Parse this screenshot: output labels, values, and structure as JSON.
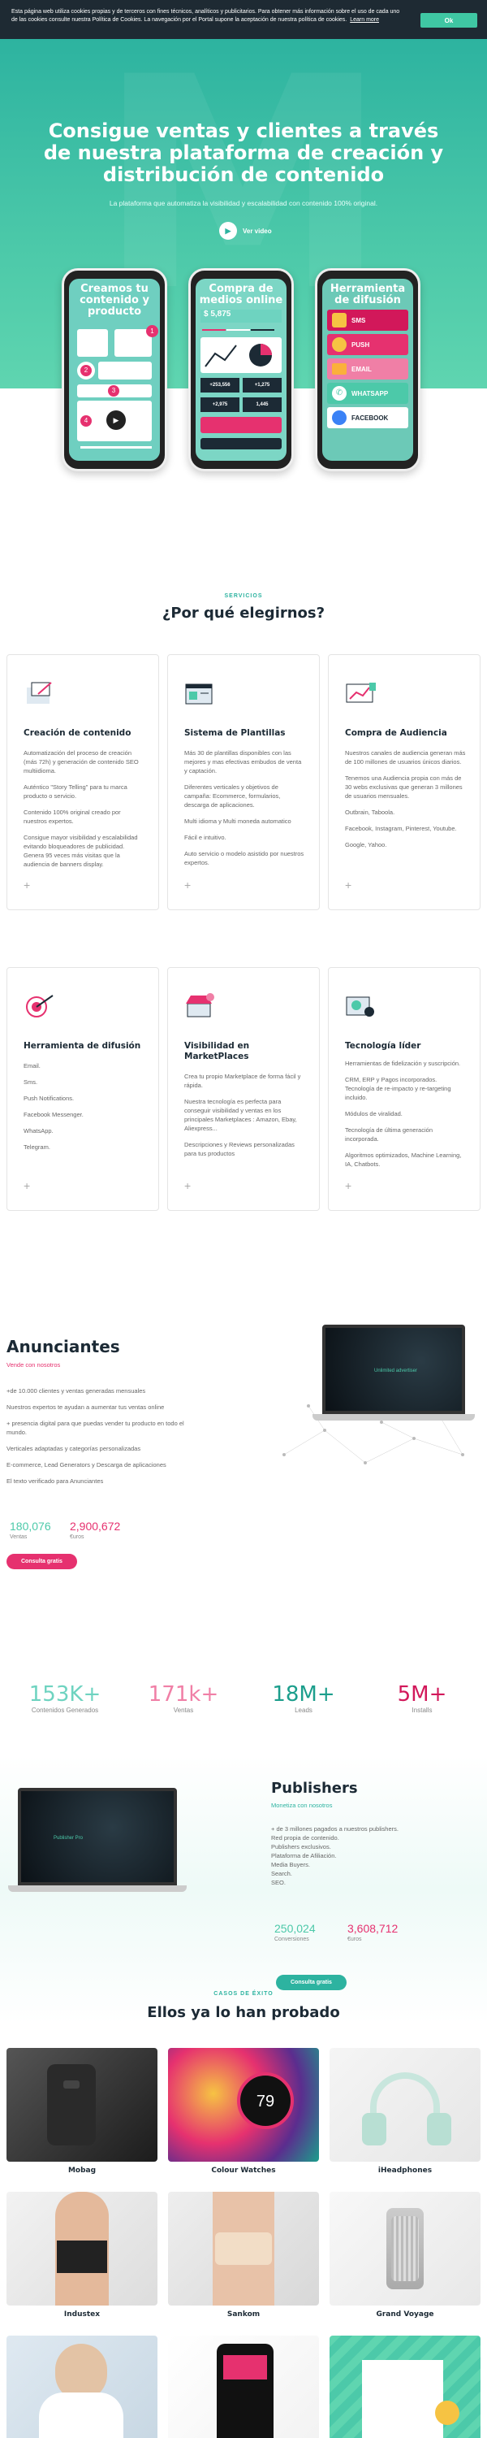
{
  "cookie": {
    "text": "Esta página web utiliza cookies propias y de terceros con fines técnicos, analíticos y publicitarios. Para obtener más información sobre el uso de cada uno de las cookies consulte nuestra Política de Cookies. La navegación por el Portal supone la aceptación de nuestra política de cookies.",
    "learn_more": "Learn more",
    "ok_label": "Ok"
  },
  "hero": {
    "title": "Consigue ventas y clientes a través de nuestra plataforma de creación y distribución de contenido",
    "subtitle": "La plataforma que automatiza la visibilidad y escalabilidad con contenido 100% original.",
    "video_label": "Ver video",
    "phone1_title": "Creamos tu contenido y producto",
    "phone2_title": "Compra de medios online",
    "phone2_value": "$ 5,875",
    "phone2_stats": [
      "+253,556",
      "+1,275",
      "+2,975",
      "1,445"
    ],
    "phone3_title": "Herramienta de difusión",
    "phone3_items": [
      "SMS",
      "PUSH",
      "EMAIL",
      "WHATSAPP",
      "FACEBOOK"
    ]
  },
  "services": {
    "eyebrow": "SERVICIOS",
    "title": "¿Por qué elegirnos?",
    "cards": [
      {
        "title": "Creación de contenido",
        "lines": [
          "Automatización del proceso de creación (más 72h) y generación de contenido SEO multiidioma.",
          "Auténtico \"Story Telling\" para tu marca producto o servicio.",
          "Contenido 100% original creado por nuestros expertos.",
          "Consigue mayor visibilidad y escalabilidad evitando bloqueadores de publicidad. Genera 95 veces más visitas que la audiencia de banners display."
        ]
      },
      {
        "title": "Sistema de Plantillas",
        "lines": [
          "Más 30 de plantillas disponibles con las mejores y mas efectivas embudos de venta y captación.",
          "Diferentes verticales y objetivos de campaña: Ecommerce, formularios, descarga de aplicaciones.",
          "Multi idioma y Multi moneda automatico",
          "Fácil e intuitivo.",
          "Auto servicio o modelo asistido por nuestros expertos."
        ]
      },
      {
        "title": "Compra de Audiencia",
        "lines": [
          "Nuestros canales de audiencia generan más de 100 millones de usuarios únicos diarios.",
          "Tenemos una Audiencia propia con más de 30 webs exclusivas que generan 3 millones de usuarios mensuales.",
          "Outbrain, Taboola.",
          "Facebook, Instagram, Pinterest, Youtube.",
          "Google, Yahoo."
        ]
      },
      {
        "title": "Herramienta de difusión",
        "lines": [
          "Email.",
          "Sms.",
          "Push Notifications.",
          "Facebook Messenger.",
          "WhatsApp.",
          "Telegram."
        ]
      },
      {
        "title": "Visibilidad en MarketPlaces",
        "lines": [
          "Crea tu propio Marketplace de forma fácil y rápida.",
          "Nuestra tecnología es perfecta para conseguir visibilidad y ventas en los principales Marketplaces : Amazon, Ebay, Aliexpress...",
          "Descripciones y Reviews personalizadas para tus productos"
        ]
      },
      {
        "title": "Tecnología líder",
        "lines": [
          "Herramientas de fidelización y suscripción.",
          "CRM, ERP y Pagos incorporados. Tecnología de re-impacto y re-targeting incluido.",
          "Módulos de viralidad.",
          "Tecnología de última generación incorporada.",
          "Algoritmos optimizados, Machine Learning, IA, Chatbots."
        ]
      }
    ]
  },
  "advertisers": {
    "title": "Anunciantes",
    "subtitle": "Vende con nosotros",
    "lines": [
      "+de 10.000 clientes y ventas generadas mensuales",
      "Nuestros expertos te ayudan a aumentar tus ventas online",
      "+ presencia digital para que puedas vender tu producto en todo el mundo.",
      "Verticales adaptadas y categorías personalizadas",
      "E-commerce, Lead Generators y Descarga de aplicaciones",
      "El texto verificado para Anunciantes"
    ],
    "stat1_value": "180,076",
    "stat1_label": "Ventas",
    "stat2_value": "2,900,672",
    "stat2_label": "€uros",
    "cta": "Consulta gratis",
    "laptop_text": "Unlimited advertiser"
  },
  "metrics": [
    {
      "value": "153K+",
      "label": "Contenidos Generados",
      "color": "#6ed3c0"
    },
    {
      "value": "171k+",
      "label": "Ventas",
      "color": "#f07fa6"
    },
    {
      "value": "18M+",
      "label": "Leads",
      "color": "#1c9e8c"
    },
    {
      "value": "5M+",
      "label": "Installs",
      "color": "#d2185a"
    }
  ],
  "publishers": {
    "title": "Publishers",
    "subtitle": "Monetiza con nosotros",
    "lines": [
      "+ de 3 millones pagados a nuestros publishers.",
      "Red propia de contenido.",
      "Publishers exclusivos.",
      "Plataforma de Afiliación.",
      "Media Buyers.",
      "Search.",
      "SEO."
    ],
    "stat1_value": "250,024",
    "stat1_label": "Conversiones",
    "stat2_value": "3,608,712",
    "stat2_label": "€uros",
    "cta": "Consulta gratis",
    "laptop_text": "Publisher Pro"
  },
  "cases": {
    "eyebrow": "CASOS DE ÉXITO",
    "title": "Ellos ya lo han probado",
    "items": [
      "Mobag",
      "Colour Watches",
      "iHeadphones",
      "Industex",
      "Sankom",
      "Grand Voyage"
    ],
    "watch_time": "79"
  }
}
